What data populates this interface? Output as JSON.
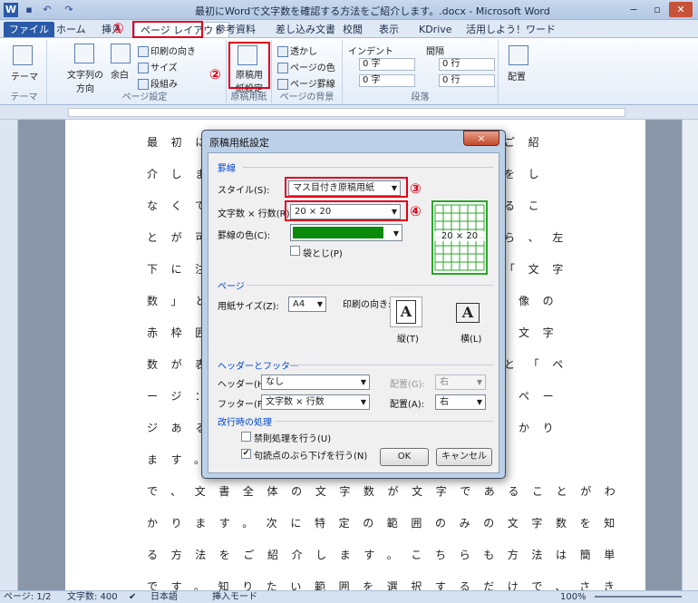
{
  "window": {
    "title": "最初にWordで文字数を確認する方法をご紹介します。.docx - Microsoft Word"
  },
  "tabs": [
    "ファイル",
    "ホーム",
    "挿入",
    "ページ レイアウト",
    "参考資料",
    "差し込み文書",
    "校閲",
    "表示",
    "KDrive",
    "活用しよう！ワード"
  ],
  "ribbon": {
    "theme": {
      "label": "テーマ",
      "group": "テーマ"
    },
    "page_setup": {
      "text_direction": "文字列の方向",
      "margins": "余白",
      "orientation": "印刷の向き",
      "size": "サイズ",
      "columns": "段組み",
      "group": "ページ設定"
    },
    "manuscript": {
      "button": "原稿用紙設定",
      "group": "原稿用紙"
    },
    "background": {
      "watermark": "透かし",
      "page_color": "ページの色",
      "page_borders": "ページ罫線",
      "group": "ページの背景"
    },
    "paragraph": {
      "indent": "インデント",
      "spacing": "間隔",
      "indent_left": "0 字",
      "indent_right": "0 字",
      "spacing_before": "0 行",
      "spacing_after": "0 行",
      "group": "段落"
    },
    "arrange": {
      "label": "配置"
    }
  },
  "annotations": {
    "n1": "①",
    "n2": "②",
    "n3": "③",
    "n4": "④"
  },
  "document": {
    "lines": [
      "最初に",
      "介しま",
      "なくて",
      "とが可",
      "下に注",
      "数」と",
      "赤枠囲",
      "数が表",
      "ージ：",
      "ジある",
      "ます。",
      "で、文書全体の文字数が文字であることがわ",
      "かります。次に特定の範囲のみの文字数を知",
      "る方法をご紹介します。こちらも方法は簡単",
      "です。知りたい範囲を選択するだけで、さき"
    ],
    "right_lines": [
      "ご紹",
      "をし",
      "るこ",
      "ら、左",
      "「文字",
      "像の",
      "文字",
      "と「ペ",
      "ペー",
      "かり"
    ]
  },
  "dialog": {
    "title": "原稿用紙設定",
    "close": "×",
    "section_grid": "罫線",
    "style_label": "スタイル(S):",
    "style_value": "マス目付き原稿用紙",
    "chars_label": "文字数 × 行数(R):",
    "chars_value": "20 × 20",
    "color_label": "罫線の色(C):",
    "fold_label": "袋とじ(P)",
    "preview_text": "20 × 20",
    "section_page": "ページ",
    "paper_size_label": "用紙サイズ(Z):",
    "paper_size_value": "A4",
    "orientation_label": "印刷の向き:",
    "portrait": "縦(T)",
    "landscape": "横(L)",
    "orient_glyph": "A",
    "section_hf": "ヘッダーとフッター",
    "header_label": "ヘッダー(H):",
    "header_value": "なし",
    "header_align_label": "配置(G):",
    "header_align_value": "右",
    "footer_label": "フッター(F):",
    "footer_value": "文字数 × 行数",
    "footer_align_label": "配置(A):",
    "footer_align_value": "右",
    "section_wrap": "改行時の処理",
    "kinsoku": "禁則処理を行う(U)",
    "burasage": "句読点のぶら下げを行う(N)",
    "ok": "OK",
    "cancel": "キャンセル",
    "grid_color": "#0a8a0a"
  },
  "status": {
    "page": "ページ: 1/2",
    "words": "文字数: 400",
    "lang": "日本語",
    "mode": "挿入モード",
    "zoom": "100%"
  }
}
